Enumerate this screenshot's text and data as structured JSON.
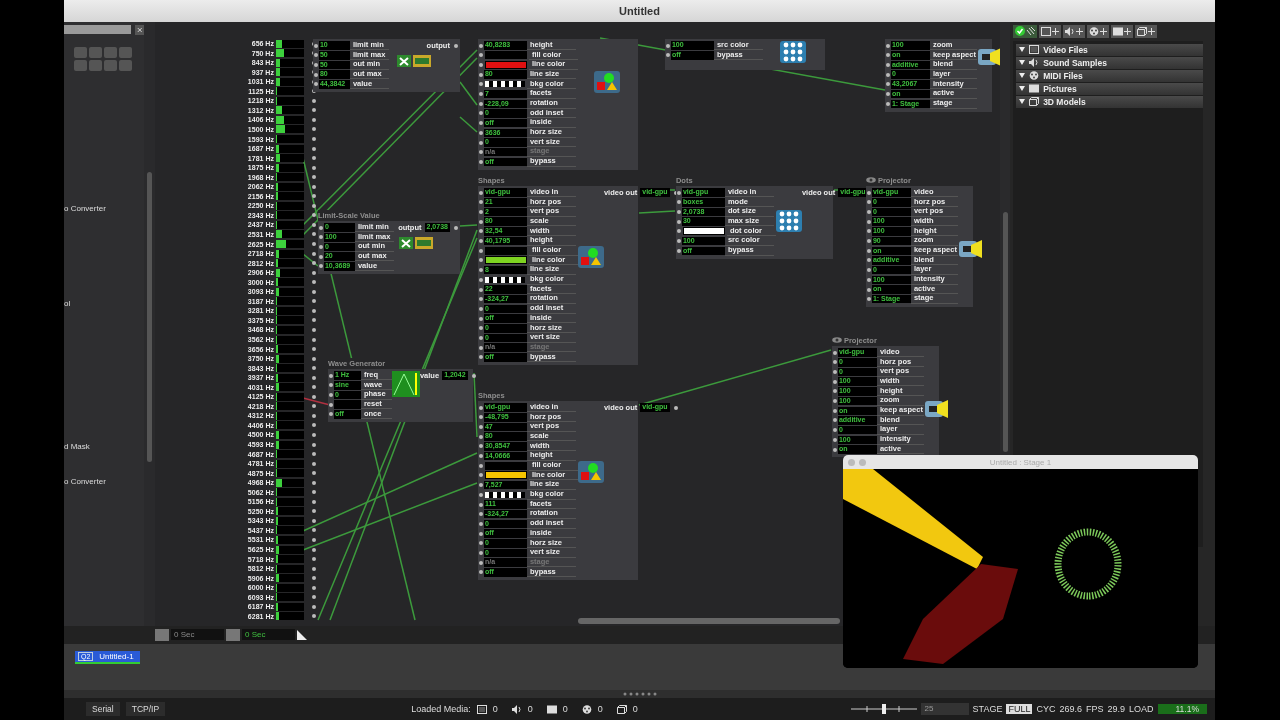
{
  "window": {
    "title": "Untitled"
  },
  "sidebar": {
    "items": [
      {
        "label": "o Converter"
      },
      {
        "label": "ol"
      },
      {
        "label": "d Mask"
      },
      {
        "label": "o Converter"
      }
    ]
  },
  "spectrum": {
    "bands": [
      {
        "label": "656 Hz",
        "level": 0.2
      },
      {
        "label": "750 Hz",
        "level": 0.3
      },
      {
        "label": "843 Hz",
        "level": 0.14
      },
      {
        "label": "937 Hz",
        "level": 0.14
      },
      {
        "label": "1031 Hz",
        "level": 0.14
      },
      {
        "label": "1125 Hz",
        "level": 0.05
      },
      {
        "label": "1218 Hz",
        "level": 0.05
      },
      {
        "label": "1312 Hz",
        "level": 0.2
      },
      {
        "label": "1406 Hz",
        "level": 0.28
      },
      {
        "label": "1500 Hz",
        "level": 0.32
      },
      {
        "label": "1593 Hz",
        "level": 0.05
      },
      {
        "label": "1687 Hz",
        "level": 0.1
      },
      {
        "label": "1781 Hz",
        "level": 0.15
      },
      {
        "label": "1875 Hz",
        "level": 0.1
      },
      {
        "label": "1968 Hz",
        "level": 0.05
      },
      {
        "label": "2062 Hz",
        "level": 0.08
      },
      {
        "label": "2156 Hz",
        "level": 0.08
      },
      {
        "label": "2250 Hz",
        "level": 0.05
      },
      {
        "label": "2343 Hz",
        "level": 0.03
      },
      {
        "label": "2437 Hz",
        "level": 0.05
      },
      {
        "label": "2531 Hz",
        "level": 0.2
      },
      {
        "label": "2625 Hz",
        "level": 0.35
      },
      {
        "label": "2718 Hz",
        "level": 0.1
      },
      {
        "label": "2812 Hz",
        "level": 0.08
      },
      {
        "label": "2906 Hz",
        "level": 0.15
      },
      {
        "label": "3000 Hz",
        "level": 0.08
      },
      {
        "label": "3093 Hz",
        "level": 0.1
      },
      {
        "label": "3187 Hz",
        "level": 0.03
      },
      {
        "label": "3281 Hz",
        "level": 0.05
      },
      {
        "label": "3375 Hz",
        "level": 0.05
      },
      {
        "label": "3468 Hz",
        "level": 0.05
      },
      {
        "label": "3562 Hz",
        "level": 0.05
      },
      {
        "label": "3656 Hz",
        "level": 0.08
      },
      {
        "label": "3750 Hz",
        "level": 0.12
      },
      {
        "label": "3843 Hz",
        "level": 0.05
      },
      {
        "label": "3937 Hz",
        "level": 0.06
      },
      {
        "label": "4031 Hz",
        "level": 0.1
      },
      {
        "label": "4125 Hz",
        "level": 0.03
      },
      {
        "label": "4218 Hz",
        "level": 0.03
      },
      {
        "label": "4312 Hz",
        "level": 0.05
      },
      {
        "label": "4406 Hz",
        "level": 0.05
      },
      {
        "label": "4500 Hz",
        "level": 0.1
      },
      {
        "label": "4593 Hz",
        "level": 0.1
      },
      {
        "label": "4687 Hz",
        "level": 0.05
      },
      {
        "label": "4781 Hz",
        "level": 0.05
      },
      {
        "label": "4875 Hz",
        "level": 0.05
      },
      {
        "label": "4968 Hz",
        "level": 0.2
      },
      {
        "label": "5062 Hz",
        "level": 0.05
      },
      {
        "label": "5156 Hz",
        "level": 0.05
      },
      {
        "label": "5250 Hz",
        "level": 0.08
      },
      {
        "label": "5343 Hz",
        "level": 0.08
      },
      {
        "label": "5437 Hz",
        "level": 0.05
      },
      {
        "label": "5531 Hz",
        "level": 0.06
      },
      {
        "label": "5625 Hz",
        "level": 0.12
      },
      {
        "label": "5718 Hz",
        "level": 0.08
      },
      {
        "label": "5812 Hz",
        "level": 0.05
      },
      {
        "label": "5906 Hz",
        "level": 0.1
      },
      {
        "label": "6000 Hz",
        "level": 0.05
      },
      {
        "label": "6093 Hz",
        "level": 0.03
      },
      {
        "label": "6187 Hz",
        "level": 0.06
      },
      {
        "label": "6281 Hz",
        "level": 0.1
      }
    ]
  },
  "actors": [
    {
      "kind": "limit-scale",
      "inputs": [
        {
          "kind": "number",
          "value": "10",
          "label": "limit min"
        },
        {
          "kind": "number",
          "value": "50",
          "label": "limit max"
        },
        {
          "kind": "number",
          "value": "50",
          "label": "out min"
        },
        {
          "kind": "number",
          "value": "80",
          "label": "out max"
        },
        {
          "kind": "number",
          "value": "44,3842",
          "label": "value"
        }
      ],
      "outputs": [
        {
          "label": "output"
        }
      ]
    },
    {
      "kind": "limit-scale",
      "title": "Limit-Scale Value",
      "inputs": [
        {
          "kind": "number",
          "value": "0",
          "label": "limit min"
        },
        {
          "kind": "number",
          "value": "100",
          "label": "limit max"
        },
        {
          "kind": "number",
          "value": "0",
          "label": "out min"
        },
        {
          "kind": "number",
          "value": "20",
          "label": "out max"
        },
        {
          "kind": "number",
          "value": "10,3689",
          "label": "value"
        }
      ],
      "outputs": [
        {
          "label": "output",
          "value": "2,0738"
        }
      ]
    },
    {
      "kind": "wave-generator",
      "title": "Wave Generator",
      "inputs": [
        {
          "kind": "number",
          "value": "1 Hz",
          "label": "freq"
        },
        {
          "kind": "number",
          "value": "sine",
          "label": "wave"
        },
        {
          "kind": "number",
          "value": "0",
          "label": "phase"
        },
        {
          "kind": "trigger",
          "label": "reset"
        },
        {
          "kind": "number",
          "value": "off",
          "label": "once"
        }
      ],
      "outputs": [
        {
          "label": "value",
          "value": "1,2042"
        }
      ]
    },
    {
      "kind": "shapes",
      "inputs": [
        {
          "kind": "number",
          "value": "40,8283",
          "label": "height"
        },
        {
          "kind": "color",
          "color": "#000000",
          "label": "fill color"
        },
        {
          "kind": "color",
          "color": "#e01010",
          "label": "line color"
        },
        {
          "kind": "number",
          "value": "80",
          "label": "line size"
        },
        {
          "kind": "pattern",
          "label": "bkg color"
        },
        {
          "kind": "number",
          "value": "7",
          "label": "facets"
        },
        {
          "kind": "number",
          "value": "-228,09",
          "label": "rotation"
        },
        {
          "kind": "number",
          "value": "0",
          "label": "odd inset"
        },
        {
          "kind": "number",
          "value": "off",
          "label": "inside"
        },
        {
          "kind": "number",
          "value": "3636",
          "label": "horz size"
        },
        {
          "kind": "number",
          "value": "0",
          "label": "vert size"
        },
        {
          "kind": "dimmed",
          "value": "n/a",
          "label": "stage"
        },
        {
          "kind": "number",
          "value": "off",
          "label": "bypass"
        }
      ]
    },
    {
      "kind": "shapes",
      "title": "Shapes",
      "inputs": [
        {
          "kind": "number",
          "value": "vid-gpu",
          "label": "video in"
        },
        {
          "kind": "number",
          "value": "21",
          "label": "horz pos"
        },
        {
          "kind": "number",
          "value": "2",
          "label": "vert pos"
        },
        {
          "kind": "number",
          "value": "80",
          "label": "scale"
        },
        {
          "kind": "number",
          "value": "32,54",
          "label": "width"
        },
        {
          "kind": "number",
          "value": "40,1795",
          "label": "height"
        },
        {
          "kind": "color",
          "color": "#000000",
          "label": "fill color"
        },
        {
          "kind": "color",
          "color": "#7ed321",
          "label": "line color"
        },
        {
          "kind": "number",
          "value": "8",
          "label": "line size"
        },
        {
          "kind": "pattern",
          "label": "bkg color"
        },
        {
          "kind": "number",
          "value": "22",
          "label": "facets"
        },
        {
          "kind": "number",
          "value": "-324,27",
          "label": "rotation"
        },
        {
          "kind": "number",
          "value": "0",
          "label": "odd inset"
        },
        {
          "kind": "number",
          "value": "off",
          "label": "inside"
        },
        {
          "kind": "number",
          "value": "0",
          "label": "horz size"
        },
        {
          "kind": "number",
          "value": "0",
          "label": "vert size"
        },
        {
          "kind": "dimmed",
          "value": "n/a",
          "label": "stage"
        },
        {
          "kind": "number",
          "value": "off",
          "label": "bypass"
        }
      ],
      "outputs": [
        {
          "label": "video out",
          "value": "vid-gpu"
        }
      ]
    },
    {
      "kind": "shapes",
      "title": "Shapes",
      "inputs": [
        {
          "kind": "number",
          "value": "vid-gpu",
          "label": "video in"
        },
        {
          "kind": "number",
          "value": "-48,795",
          "label": "horz pos"
        },
        {
          "kind": "number",
          "value": "47",
          "label": "vert pos"
        },
        {
          "kind": "number",
          "value": "80",
          "label": "scale"
        },
        {
          "kind": "number",
          "value": "30,8547",
          "label": "width"
        },
        {
          "kind": "number",
          "value": "14,0666",
          "label": "height"
        },
        {
          "kind": "color",
          "color": "#000000",
          "label": "fill color"
        },
        {
          "kind": "color",
          "color": "#f5c400",
          "label": "line color"
        },
        {
          "kind": "number",
          "value": "7,527",
          "label": "line size"
        },
        {
          "kind": "pattern",
          "label": "bkg color"
        },
        {
          "kind": "number",
          "value": "111",
          "label": "facets"
        },
        {
          "kind": "number",
          "value": "-324,27",
          "label": "rotation"
        },
        {
          "kind": "number",
          "value": "0",
          "label": "odd inset"
        },
        {
          "kind": "number",
          "value": "off",
          "label": "inside"
        },
        {
          "kind": "number",
          "value": "0",
          "label": "horz size"
        },
        {
          "kind": "number",
          "value": "0",
          "label": "vert size"
        },
        {
          "kind": "dimmed",
          "value": "n/a",
          "label": "stage"
        },
        {
          "kind": "number",
          "value": "off",
          "label": "bypass"
        }
      ],
      "outputs": [
        {
          "label": "video out",
          "value": "vid-gpu"
        }
      ]
    },
    {
      "kind": "dots",
      "inputs": [
        {
          "kind": "number",
          "value": "100",
          "label": "src color"
        },
        {
          "kind": "number",
          "value": "off",
          "label": "bypass"
        }
      ]
    },
    {
      "kind": "dots",
      "title": "Dots",
      "inputs": [
        {
          "kind": "number",
          "value": "vid-gpu",
          "label": "video in"
        },
        {
          "kind": "number",
          "value": "boxes",
          "label": "mode"
        },
        {
          "kind": "number",
          "value": "2,0738",
          "label": "dot size"
        },
        {
          "kind": "number",
          "value": "30",
          "label": "max size"
        },
        {
          "kind": "color",
          "color": "#ffffff",
          "label": "dot color"
        },
        {
          "kind": "number",
          "value": "100",
          "label": "src color"
        },
        {
          "kind": "number",
          "value": "off",
          "label": "bypass"
        }
      ],
      "outputs": [
        {
          "label": "video out",
          "value": "vid-gpu"
        }
      ]
    },
    {
      "kind": "projector",
      "inputs": [
        {
          "kind": "number",
          "value": "100",
          "label": "zoom"
        },
        {
          "kind": "number",
          "value": "on",
          "label": "keep aspect"
        },
        {
          "kind": "number",
          "value": "additive",
          "label": "blend"
        },
        {
          "kind": "number",
          "value": "0",
          "label": "layer"
        },
        {
          "kind": "number",
          "value": "43,2067",
          "label": "intensity"
        },
        {
          "kind": "number",
          "value": "on",
          "label": "active"
        },
        {
          "kind": "number",
          "value": "1: Stage",
          "label": "stage"
        }
      ]
    },
    {
      "kind": "projector",
      "title": "Projector",
      "inputs": [
        {
          "kind": "number",
          "value": "vid-gpu",
          "label": "video"
        },
        {
          "kind": "number",
          "value": "0",
          "label": "horz pos"
        },
        {
          "kind": "number",
          "value": "0",
          "label": "vert pos"
        },
        {
          "kind": "number",
          "value": "100",
          "label": "width"
        },
        {
          "kind": "number",
          "value": "100",
          "label": "height"
        },
        {
          "kind": "number",
          "value": "90",
          "label": "zoom"
        },
        {
          "kind": "number",
          "value": "on",
          "label": "keep aspect"
        },
        {
          "kind": "number",
          "value": "additive",
          "label": "blend"
        },
        {
          "kind": "number",
          "value": "0",
          "label": "layer"
        },
        {
          "kind": "number",
          "value": "100",
          "label": "intensity"
        },
        {
          "kind": "number",
          "value": "on",
          "label": "active"
        },
        {
          "kind": "number",
          "value": "1: Stage",
          "label": "stage"
        }
      ]
    },
    {
      "kind": "projector",
      "title": "Projector",
      "inputs": [
        {
          "kind": "number",
          "value": "vid-gpu",
          "label": "video"
        },
        {
          "kind": "number",
          "value": "0",
          "label": "horz pos"
        },
        {
          "kind": "number",
          "value": "0",
          "label": "vert pos"
        },
        {
          "kind": "number",
          "value": "100",
          "label": "width"
        },
        {
          "kind": "number",
          "value": "100",
          "label": "height"
        },
        {
          "kind": "number",
          "value": "100",
          "label": "zoom"
        },
        {
          "kind": "number",
          "value": "on",
          "label": "keep aspect"
        },
        {
          "kind": "number",
          "value": "additive",
          "label": "blend"
        },
        {
          "kind": "number",
          "value": "0",
          "label": "layer"
        },
        {
          "kind": "number",
          "value": "100",
          "label": "intensity"
        },
        {
          "kind": "number",
          "value": "on",
          "label": "active"
        }
      ]
    }
  ],
  "media_panel": {
    "items": [
      {
        "kind": "video",
        "label": "Video Files",
        "expanded": true
      },
      {
        "kind": "sound",
        "label": "Sound Samples",
        "expanded": true
      },
      {
        "kind": "midi",
        "label": "MIDI Files",
        "expanded": true
      },
      {
        "kind": "picture",
        "label": "Pictures",
        "expanded": true
      },
      {
        "kind": "model",
        "label": "3D Models",
        "expanded": true
      }
    ]
  },
  "stage_window": {
    "title": "Untitled : Stage 1"
  },
  "timeline": {
    "fields": [
      {
        "value": "0 Sec",
        "disabled": true
      },
      {
        "value": "0 Sec",
        "disabled": false
      }
    ]
  },
  "scenes": [
    {
      "number": "Q2",
      "name": "Untitled-1",
      "selected": true
    }
  ],
  "status_bar": {
    "buttons": [
      "Serial",
      "TCP/IP"
    ],
    "loaded_media_label": "Loaded Media:",
    "media_counts": [
      {
        "kind": "video",
        "count": "0"
      },
      {
        "kind": "sound",
        "count": "0"
      },
      {
        "kind": "picture",
        "count": "0"
      },
      {
        "kind": "midi",
        "count": "0"
      },
      {
        "kind": "model",
        "count": "0"
      }
    ],
    "speed_slider": {
      "level": 0.5
    },
    "frame_rate": "25",
    "stage_label": "STAGE",
    "full_label": "FULL",
    "cyc_label": "CYC",
    "cyc": "269.6",
    "fps_label": "FPS",
    "fps": "29.9",
    "load_label": "LOAD",
    "load": "11.1%"
  }
}
